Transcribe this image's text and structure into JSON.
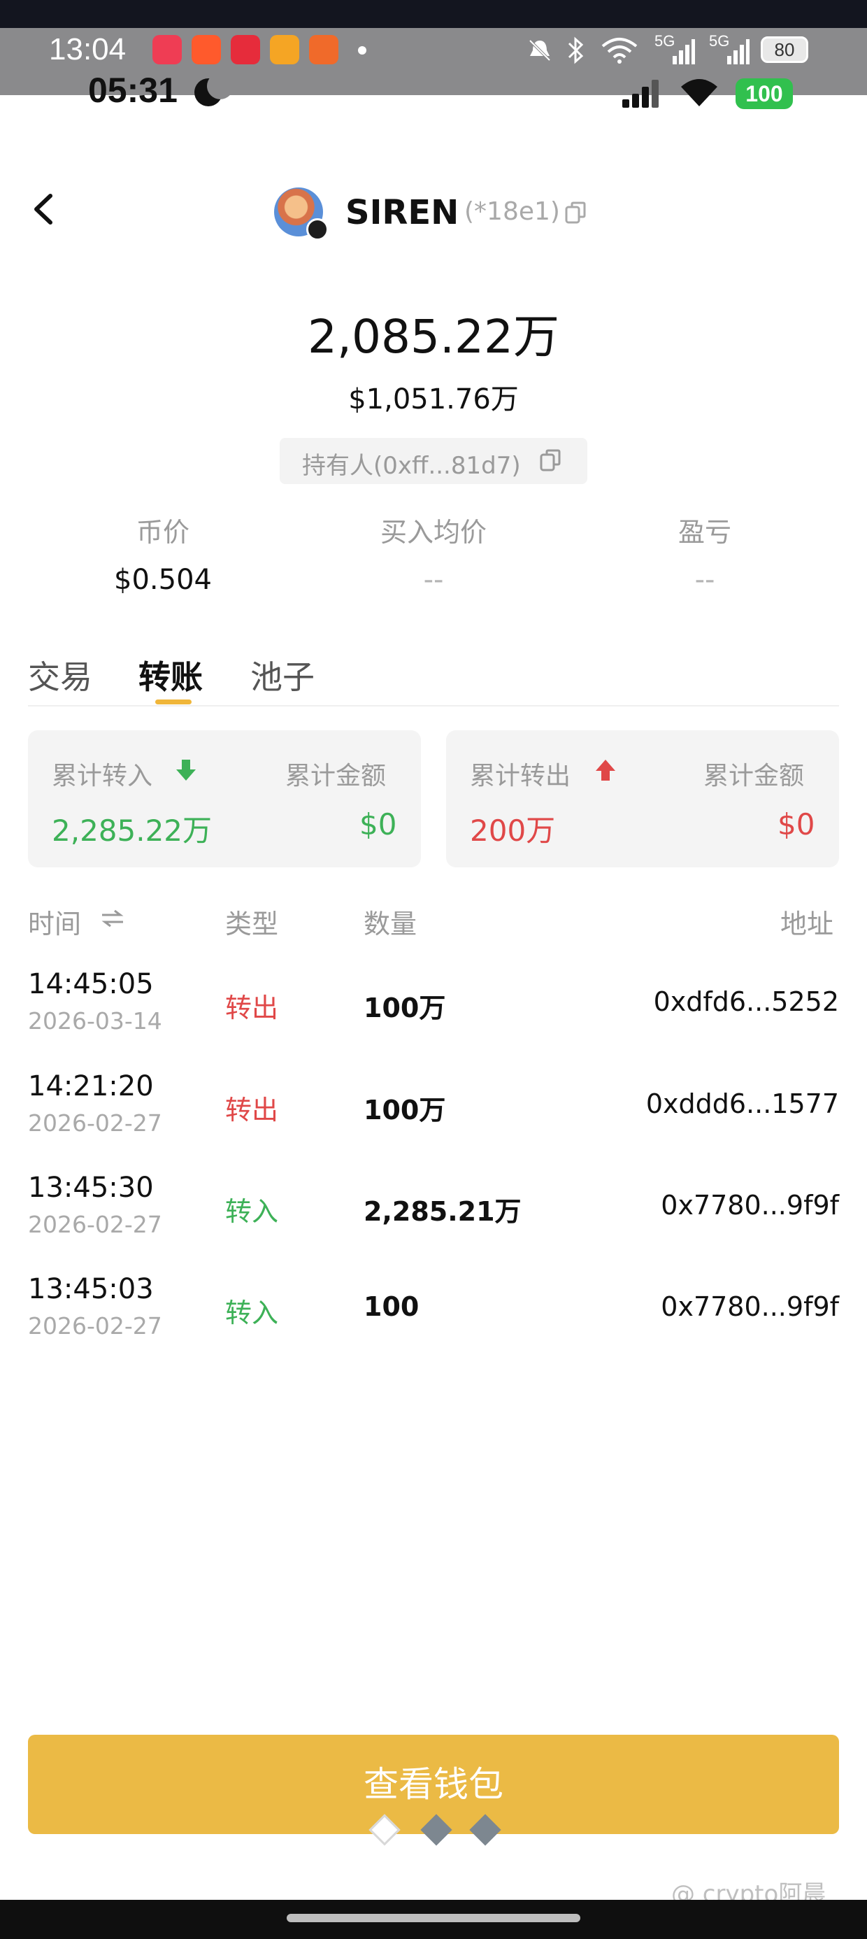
{
  "outer_status": {
    "time": "13:04",
    "battery": "80",
    "app_icon_colors": [
      "#ef3d54",
      "#ff5a2c",
      "#e62c3b",
      "#f5a524",
      "#f06a2a"
    ],
    "icons": [
      "mute-icon",
      "bluetooth-icon",
      "wifi-icon",
      "5g-signal-icon",
      "5g-signal-icon",
      "battery-icon"
    ],
    "network_label": "5G"
  },
  "status_bar": {
    "time": "05:31",
    "battery": "100",
    "icons": [
      "moon-icon",
      "cellular-icon",
      "wifi-icon",
      "battery-icon"
    ]
  },
  "header": {
    "token_name": "SIREN",
    "token_addr": "(*18e1)"
  },
  "balance": {
    "amount": "2,085.22万",
    "usd": "$1,051.76万",
    "holder": "持有人(0xff...81d7)"
  },
  "stats": [
    {
      "label": "币价",
      "value": "$0.504"
    },
    {
      "label": "买入均价",
      "value": "--"
    },
    {
      "label": "盈亏",
      "value": "--"
    }
  ],
  "tabs": [
    {
      "label": "交易",
      "active": false
    },
    {
      "label": "转账",
      "active": true
    },
    {
      "label": "池子",
      "active": false
    }
  ],
  "summary": {
    "in": {
      "label": "累计转入",
      "amount_label": "累计金额",
      "value": "2,285.22万",
      "amount": "$0"
    },
    "out": {
      "label": "累计转出",
      "amount_label": "累计金额",
      "value": "200万",
      "amount": "$0"
    }
  },
  "table": {
    "headers": {
      "time": "时间",
      "type": "类型",
      "qty": "数量",
      "addr": "地址"
    },
    "rows": [
      {
        "time": "14:45:05",
        "date": "2026-03-14",
        "type": "转出",
        "qty": "100万",
        "addr": "0xdfd6...5252"
      },
      {
        "time": "14:21:20",
        "date": "2026-02-27",
        "type": "转出",
        "qty": "100万",
        "addr": "0xddd6...1577"
      },
      {
        "time": "13:45:30",
        "date": "2026-02-27",
        "type": "转入",
        "qty": "2,285.21万",
        "addr": "0x7780...9f9f"
      },
      {
        "time": "13:45:03",
        "date": "2026-02-27",
        "type": "转入",
        "qty": "100",
        "addr": "0x7780...9f9f"
      }
    ]
  },
  "wallet_button": "查看钱包",
  "watermark": "@ crypto阿晨",
  "colors": {
    "accent": "#ebba45",
    "in_green": "#3db157",
    "out_red": "#e04848"
  }
}
